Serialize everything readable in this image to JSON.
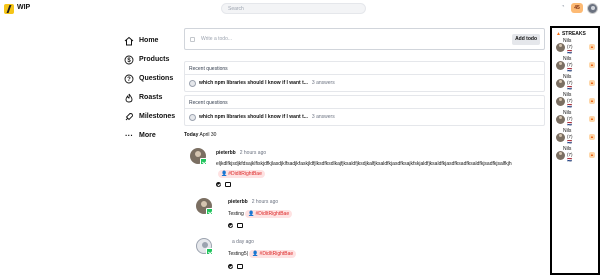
{
  "app": {
    "name": "WIP"
  },
  "search": {
    "placeholder": "Search"
  },
  "header": {
    "streak_count": "45"
  },
  "nav": [
    {
      "label": "Home"
    },
    {
      "label": "Products"
    },
    {
      "label": "Questions"
    },
    {
      "label": "Roasts"
    },
    {
      "label": "Milestones"
    },
    {
      "label": "More"
    }
  ],
  "todo": {
    "placeholder": "Write a todo...",
    "add_label": "Add todo"
  },
  "questions": [
    {
      "heading": "Recent questions",
      "title": "which npm libraries should I know if I want t...",
      "answers": "3 answers"
    },
    {
      "heading": "Recent questions",
      "title": "which npm libraries should I know if I want t...",
      "answers": "3 answers"
    }
  ],
  "date": {
    "day": "Today",
    "date": "April 30"
  },
  "posts": [
    {
      "author": "pieterbb",
      "time": "2 hours ago",
      "text": "eljkdlfkjsdjkfdsajklfiskjdfkjlasdjklfsadjkfaskjldfjlksdfksdlkajfjksaldfjksdjkalfjksaldfkjasdfksajkfskjaldfjksaldfkjasdfksadfksaldfkjsadfkjsalfkjh",
      "tag": "#DidItRightBae"
    },
    {
      "author": "pieterbb",
      "time": "2 hours ago",
      "text": "Testing",
      "tag": "#DidItRightBae"
    },
    {
      "author": "",
      "time": "a day ago",
      "text": "Testing5|",
      "tag": "#DidItRightBae"
    }
  ],
  "streaks": {
    "title": "STREAKS",
    "items": [
      {
        "name": "Nils",
        "count": "(7)",
        "flag": "🇳🇱"
      },
      {
        "name": "Nils",
        "count": "(7)",
        "flag": "🇳🇱"
      },
      {
        "name": "Nils",
        "count": "(7)",
        "flag": "🇳🇱"
      },
      {
        "name": "Nils",
        "count": "(7)",
        "flag": "🇳🇱"
      },
      {
        "name": "Nils",
        "count": "(7)",
        "flag": "🇳🇱"
      },
      {
        "name": "Nils",
        "count": "(7)",
        "flag": "🇳🇱"
      },
      {
        "name": "Nils",
        "count": "(7)",
        "flag": "🇳🇱"
      }
    ]
  },
  "colors": {
    "accent": "#f5c518",
    "tag_bg": "#fee2e2",
    "tag_fg": "#dc2626",
    "done": "#22c55e"
  }
}
